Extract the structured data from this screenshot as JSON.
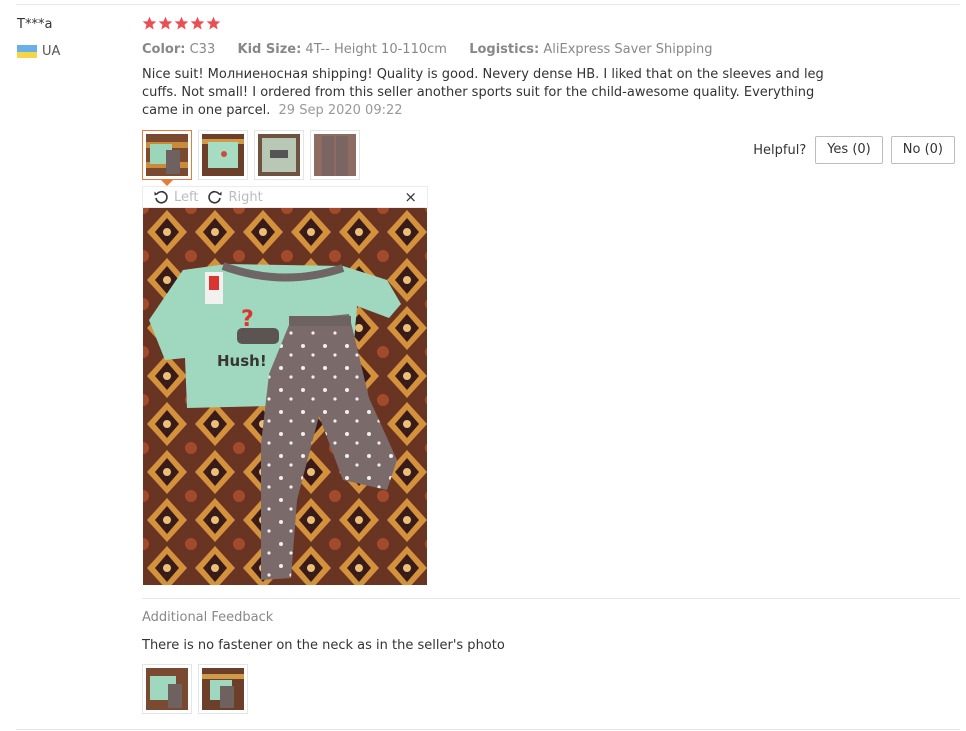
{
  "reviewer": {
    "name": "T***a",
    "country_code": "UA",
    "flag_colors": [
      "#6ab0e8",
      "#f7d548"
    ]
  },
  "rating": {
    "stars": 5,
    "star_color": "#ec4e52"
  },
  "attributes": [
    {
      "key": "Color:",
      "value": "C33"
    },
    {
      "key": "Kid Size:",
      "value": "4T-- Height 10-110cm"
    },
    {
      "key": "Logistics:",
      "value": "AliExpress Saver Shipping"
    }
  ],
  "review": {
    "text": "Nice suit! Молниеносная shipping! Quality is good. Nevery dense HB. I liked that on the sleeves and leg cuffs. Not small! I ordered from this seller another sports suit for the child-awesome quality. Everything came in one parcel.",
    "date": "29 Sep 2020 09:22"
  },
  "photos": [
    {
      "icon": "photo-thumbnail",
      "active": true
    },
    {
      "icon": "photo-thumbnail",
      "active": false
    },
    {
      "icon": "photo-thumbnail",
      "active": false
    },
    {
      "icon": "photo-thumbnail",
      "active": false
    }
  ],
  "helpful": {
    "label": "Helpful?",
    "yes_label": "Yes (0)",
    "no_label": "No (0)"
  },
  "viewer": {
    "rotate_left_label": "Left",
    "rotate_right_label": "Right",
    "close_symbol": "×",
    "accent_color": "#e9793c"
  },
  "additional_feedback": {
    "title": "Additional Feedback",
    "text": "There is no fastener on the neck as in the seller's photo",
    "photo_count": 2
  }
}
